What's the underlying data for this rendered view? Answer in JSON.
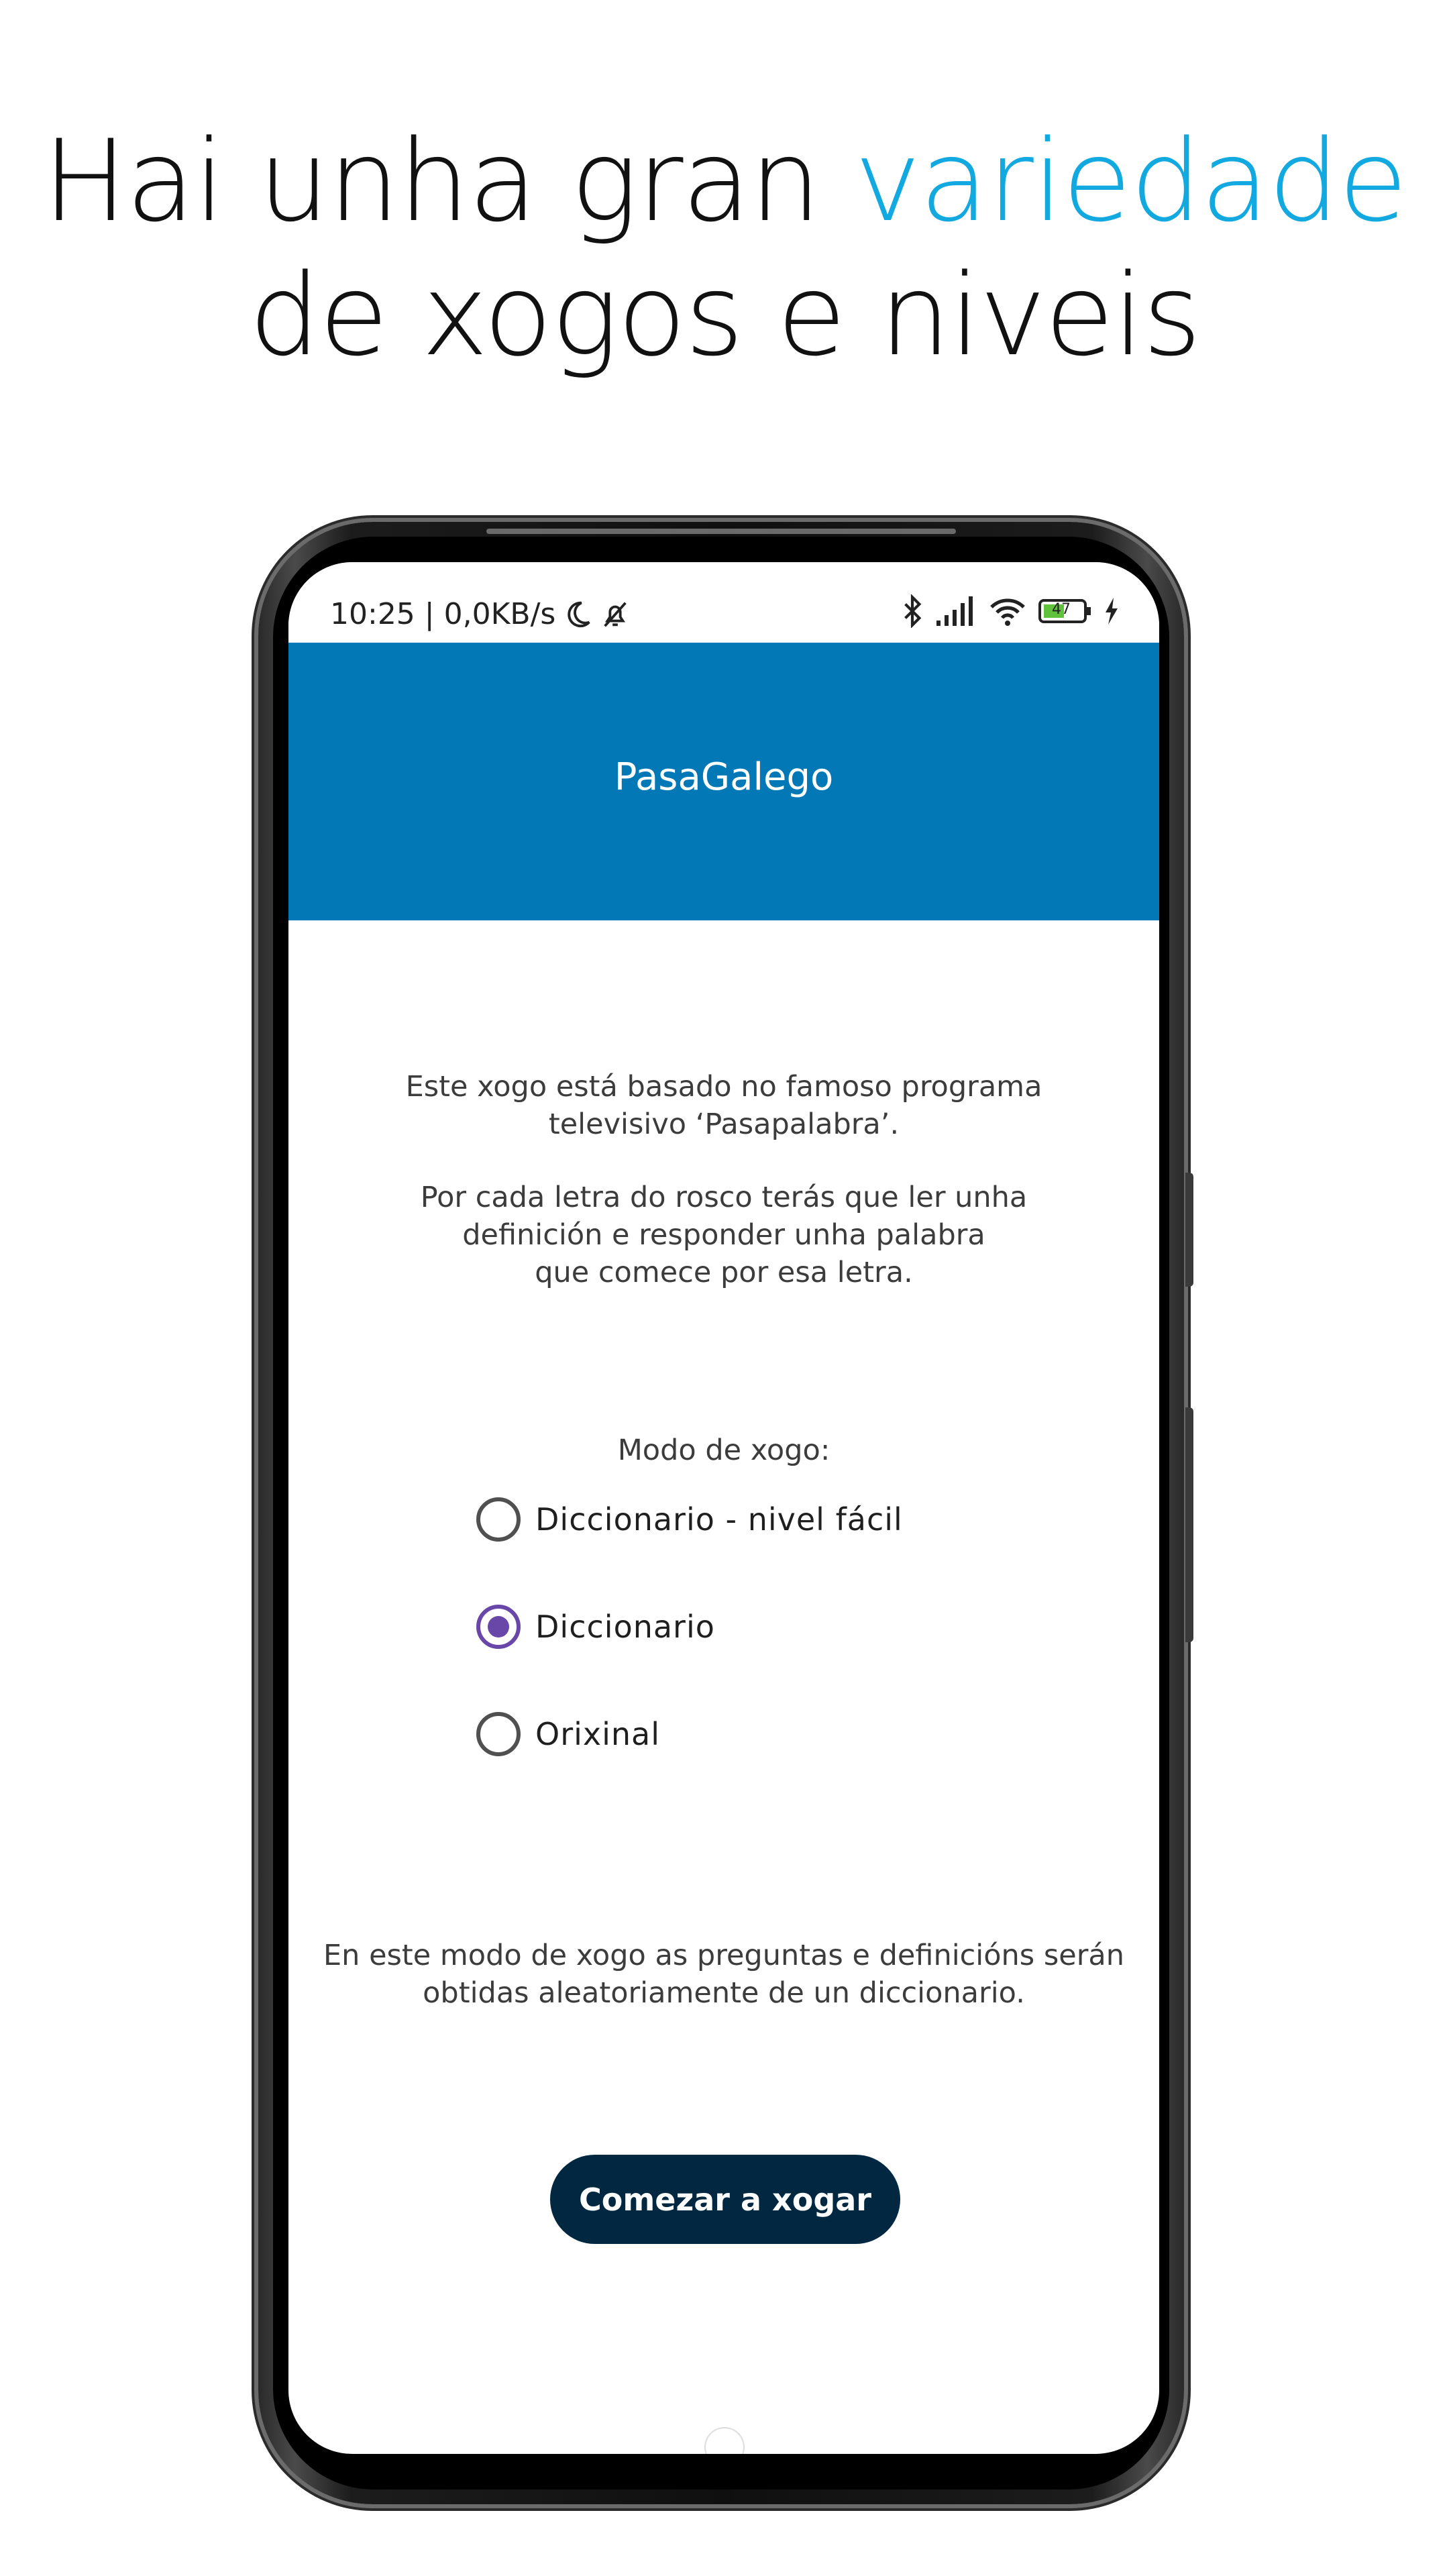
{
  "headline": {
    "line1_prefix": "Hai unha gran ",
    "line1_accent": "variedade",
    "line2": "de xogos e niveis",
    "accent_color": "#12a8e0"
  },
  "status_bar": {
    "left_text": "10:25 | 0,0KB/s",
    "left_icons": [
      "moon-icon",
      "bell-off-icon"
    ],
    "right_icons": [
      "bluetooth-icon",
      "signal-icon",
      "wifi-icon",
      "battery-icon",
      "charging-icon"
    ],
    "battery_level": "47"
  },
  "app_bar": {
    "title": "PasaGalego",
    "color": "#0279b6"
  },
  "intro": {
    "paragraph1": [
      "Este xogo está basado no famoso programa",
      "televisivo ‘Pasapalabra’."
    ],
    "paragraph2": [
      "Por cada letra do rosco terás que ler unha",
      "definición e responder unha palabra",
      "que comece por esa letra."
    ]
  },
  "game_mode": {
    "label": "Modo de xogo:",
    "options": [
      {
        "label": "Diccionario - nivel fácil",
        "checked": false
      },
      {
        "label": "Diccionario",
        "checked": true
      },
      {
        "label": "Orixinal",
        "checked": false
      }
    ],
    "selected_color": "#6847a8",
    "help_text": [
      "En este modo de xogo as preguntas e definicións serán",
      "obtidas aleatoriamente de un diccionario."
    ]
  },
  "start_button": {
    "label": "Comezar a xogar",
    "color": "#012741"
  }
}
